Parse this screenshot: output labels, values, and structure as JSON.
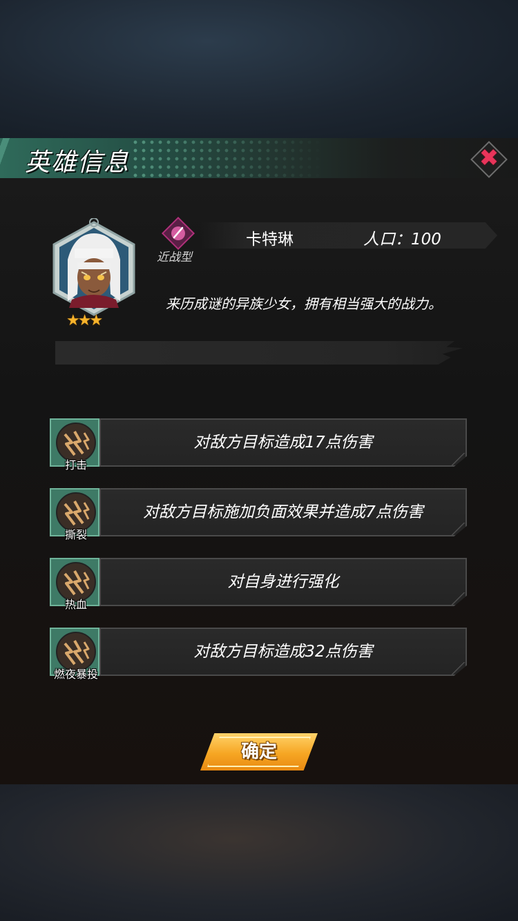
{
  "dialog": {
    "title": "英雄信息",
    "close_icon": "close-icon"
  },
  "hero": {
    "name": "卡特琳",
    "type_label": "近战型",
    "type_icon": "blade-icon",
    "population": "人口：100",
    "description": "来历成谜的异族少女，拥有相当强大的战力。",
    "stars": "★★★",
    "star_rating": 3,
    "colors": {
      "type_accent": "#b0307a",
      "star": "#f7b32b"
    }
  },
  "skills": [
    {
      "name": "打击",
      "description": "对敌方目标造成17点伤害",
      "icon": "lightning-claw-icon"
    },
    {
      "name": "撕裂",
      "description": "对敌方目标施加负面效果并造成7点伤害",
      "icon": "lightning-claw-icon"
    },
    {
      "name": "热血",
      "description": "对自身进行强化",
      "icon": "lightning-claw-icon"
    },
    {
      "name": "燃夜暴投",
      "description": "对敌方目标造成32点伤害",
      "icon": "lightning-claw-icon"
    }
  ],
  "actions": {
    "confirm_label": "确定",
    "confirm_color": "#f6a623"
  }
}
